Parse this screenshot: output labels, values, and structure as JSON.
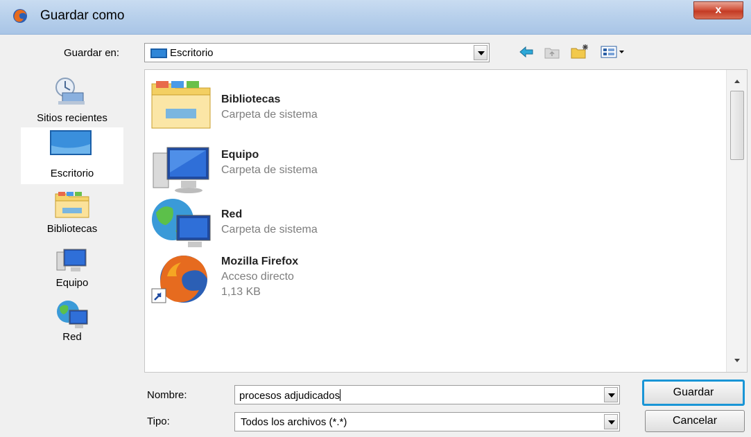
{
  "window": {
    "title": "Guardar como",
    "close_label": "x"
  },
  "location": {
    "label": "Guardar en:",
    "value": "Escritorio"
  },
  "toolbar": {
    "icons": [
      "back-arrow-icon",
      "up-folder-icon",
      "new-folder-icon",
      "view-menu-icon"
    ]
  },
  "places": [
    {
      "label": "Sitios recientes",
      "icon": "recent-places-icon"
    },
    {
      "label": "Escritorio",
      "icon": "desktop-icon",
      "selected": true
    },
    {
      "label": "Bibliotecas",
      "icon": "libraries-icon"
    },
    {
      "label": "Equipo",
      "icon": "computer-icon"
    },
    {
      "label": "Red",
      "icon": "network-icon"
    }
  ],
  "files": [
    {
      "name": "Bibliotecas",
      "type": "Carpeta de sistema",
      "size": "",
      "icon": "libraries-icon"
    },
    {
      "name": "Equipo",
      "type": "Carpeta de sistema",
      "size": "",
      "icon": "computer-icon"
    },
    {
      "name": "Red",
      "type": "Carpeta de sistema",
      "size": "",
      "icon": "network-icon"
    },
    {
      "name": "Mozilla Firefox",
      "type": "Acceso directo",
      "size": "1,13 KB",
      "icon": "firefox-shortcut-icon"
    }
  ],
  "filename": {
    "label": "Nombre:",
    "value": "procesos adjudicados"
  },
  "filetype": {
    "label": "Tipo:",
    "value": "Todos los archivos (*.*)"
  },
  "buttons": {
    "save": "Guardar",
    "cancel": "Cancelar"
  },
  "colors": {
    "accent": "#1995d6",
    "titlebar": "#b9d1ec",
    "close": "#c43a24"
  }
}
